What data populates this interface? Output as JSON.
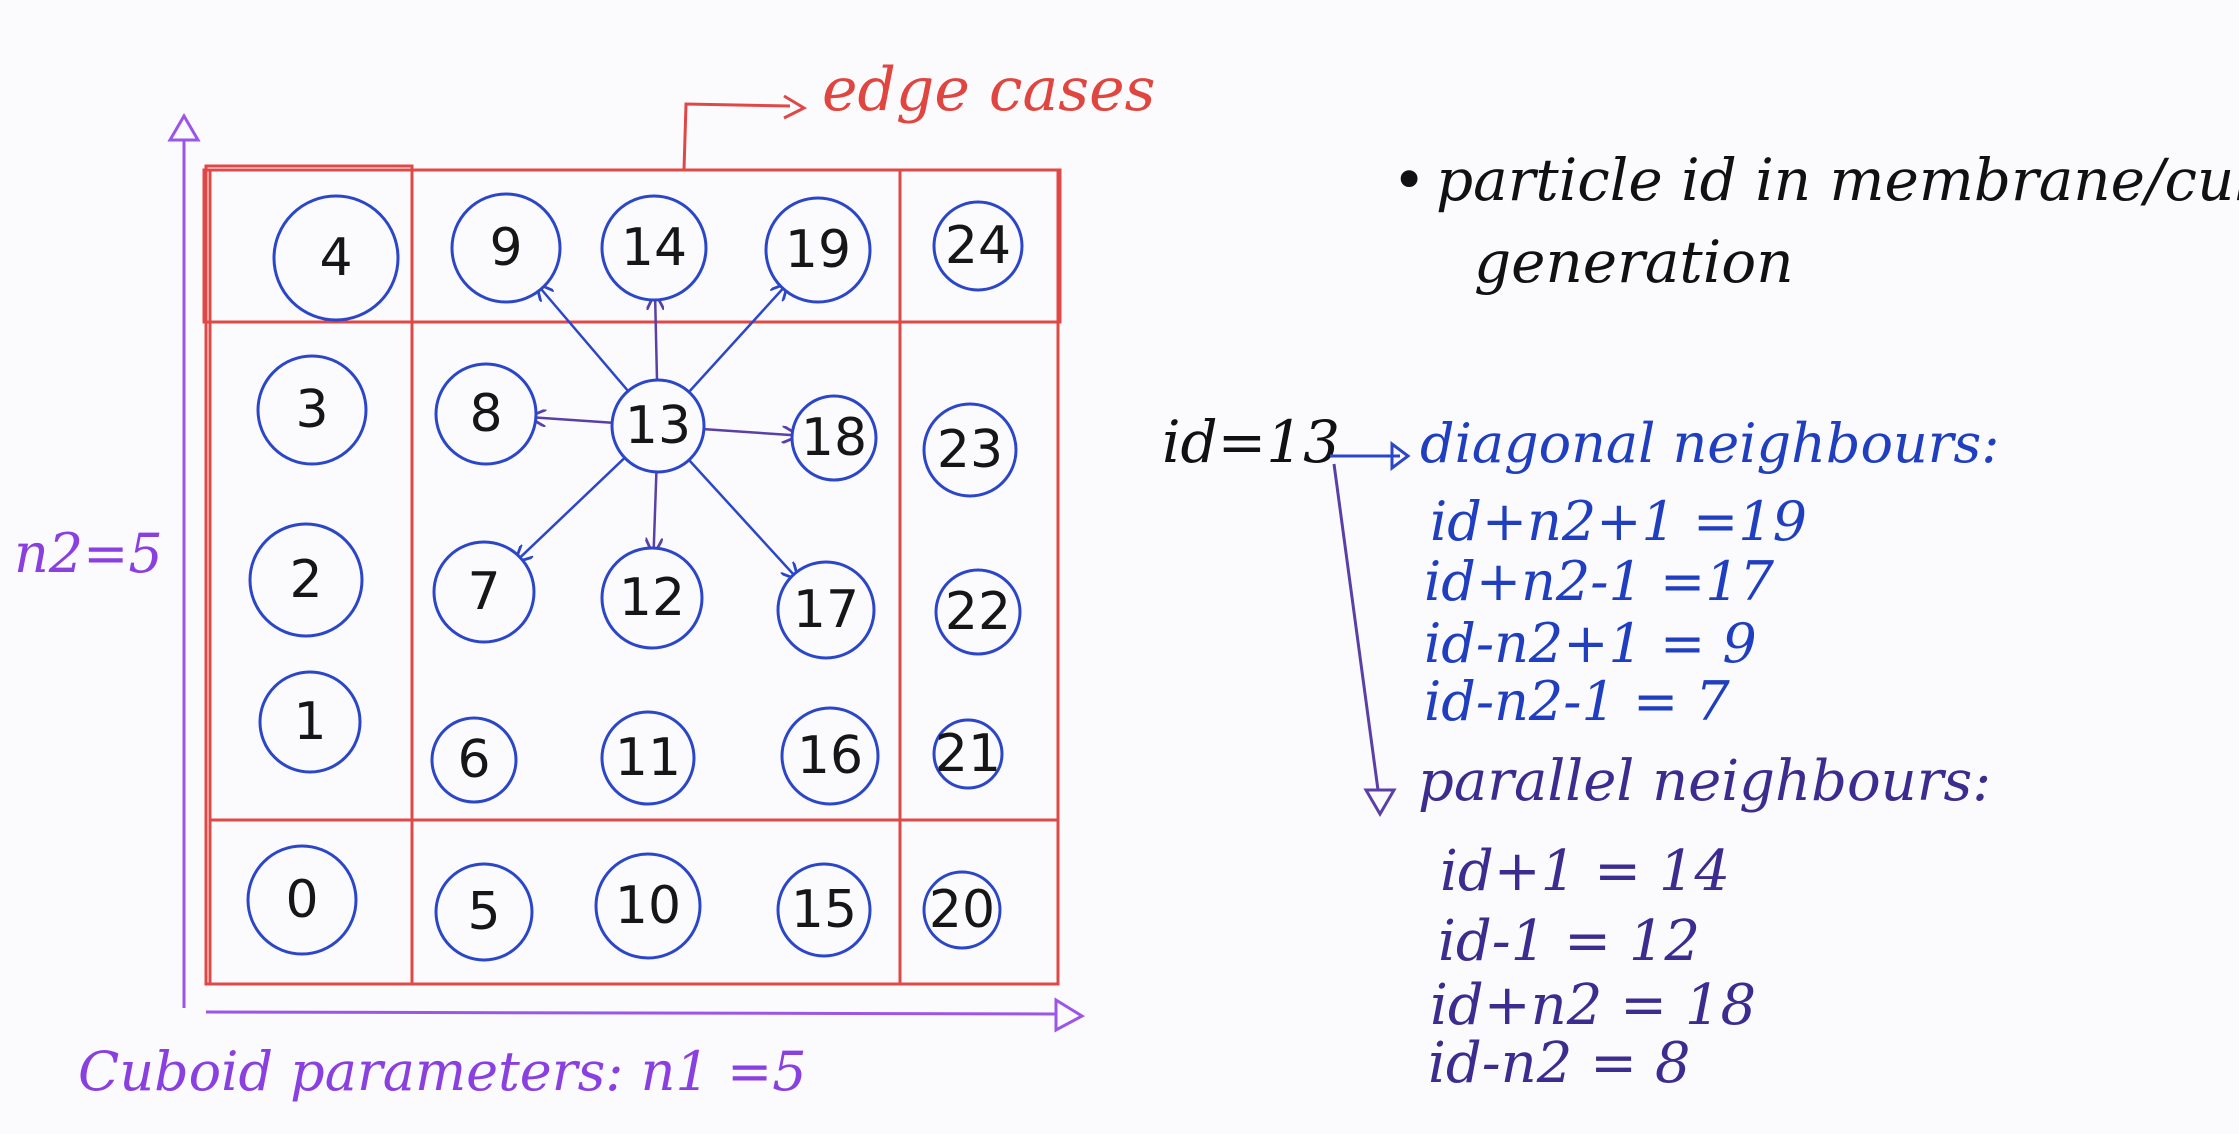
{
  "colors": {
    "grid_red": "#e04848",
    "circle_blue": "#2b46c9",
    "arrow_blue": "#2b46c9",
    "arrow_purple": "#5a3fa8",
    "axis_purple": "#9b55e8",
    "text_blue": "#1f3ec0",
    "text_purple": "#3d2c8f",
    "text_black": "#111111"
  },
  "edge_label": "edge cases",
  "axis": {
    "y_label": "n2=5",
    "x_label": "Cuboid parameters: n1 =5"
  },
  "particles": [
    {
      "id": "0"
    },
    {
      "id": "1"
    },
    {
      "id": "2"
    },
    {
      "id": "3"
    },
    {
      "id": "4"
    },
    {
      "id": "5"
    },
    {
      "id": "6"
    },
    {
      "id": "7"
    },
    {
      "id": "8"
    },
    {
      "id": "9"
    },
    {
      "id": "10"
    },
    {
      "id": "11"
    },
    {
      "id": "12"
    },
    {
      "id": "13"
    },
    {
      "id": "14"
    },
    {
      "id": "15"
    },
    {
      "id": "16"
    },
    {
      "id": "17"
    },
    {
      "id": "18"
    },
    {
      "id": "19"
    },
    {
      "id": "20"
    },
    {
      "id": "21"
    },
    {
      "id": "22"
    },
    {
      "id": "23"
    },
    {
      "id": "24"
    }
  ],
  "neighbor_arrows": [
    {
      "to": "9",
      "kind": "diagonal"
    },
    {
      "to": "14",
      "kind": "parallel"
    },
    {
      "to": "19",
      "kind": "diagonal"
    },
    {
      "to": "8",
      "kind": "parallel"
    },
    {
      "to": "18",
      "kind": "parallel"
    },
    {
      "to": "7",
      "kind": "diagonal"
    },
    {
      "to": "12",
      "kind": "parallel"
    },
    {
      "to": "17",
      "kind": "diagonal"
    }
  ],
  "notes": {
    "bullet": "•",
    "title_line1": "particle id in membrane/cuboid",
    "title_line2": "generation",
    "id_label": "id=13",
    "diagonal_heading": "diagonal neighbours:",
    "diagonal": [
      "id+n2+1 =19",
      "id+n2-1 =17",
      "id-n2+1 = 9",
      "id-n2-1 = 7"
    ],
    "parallel_heading": "parallel neighbours:",
    "parallel": [
      "id+1 = 14",
      "id-1  = 12",
      "id+n2 = 18",
      "id-n2 = 8"
    ]
  }
}
